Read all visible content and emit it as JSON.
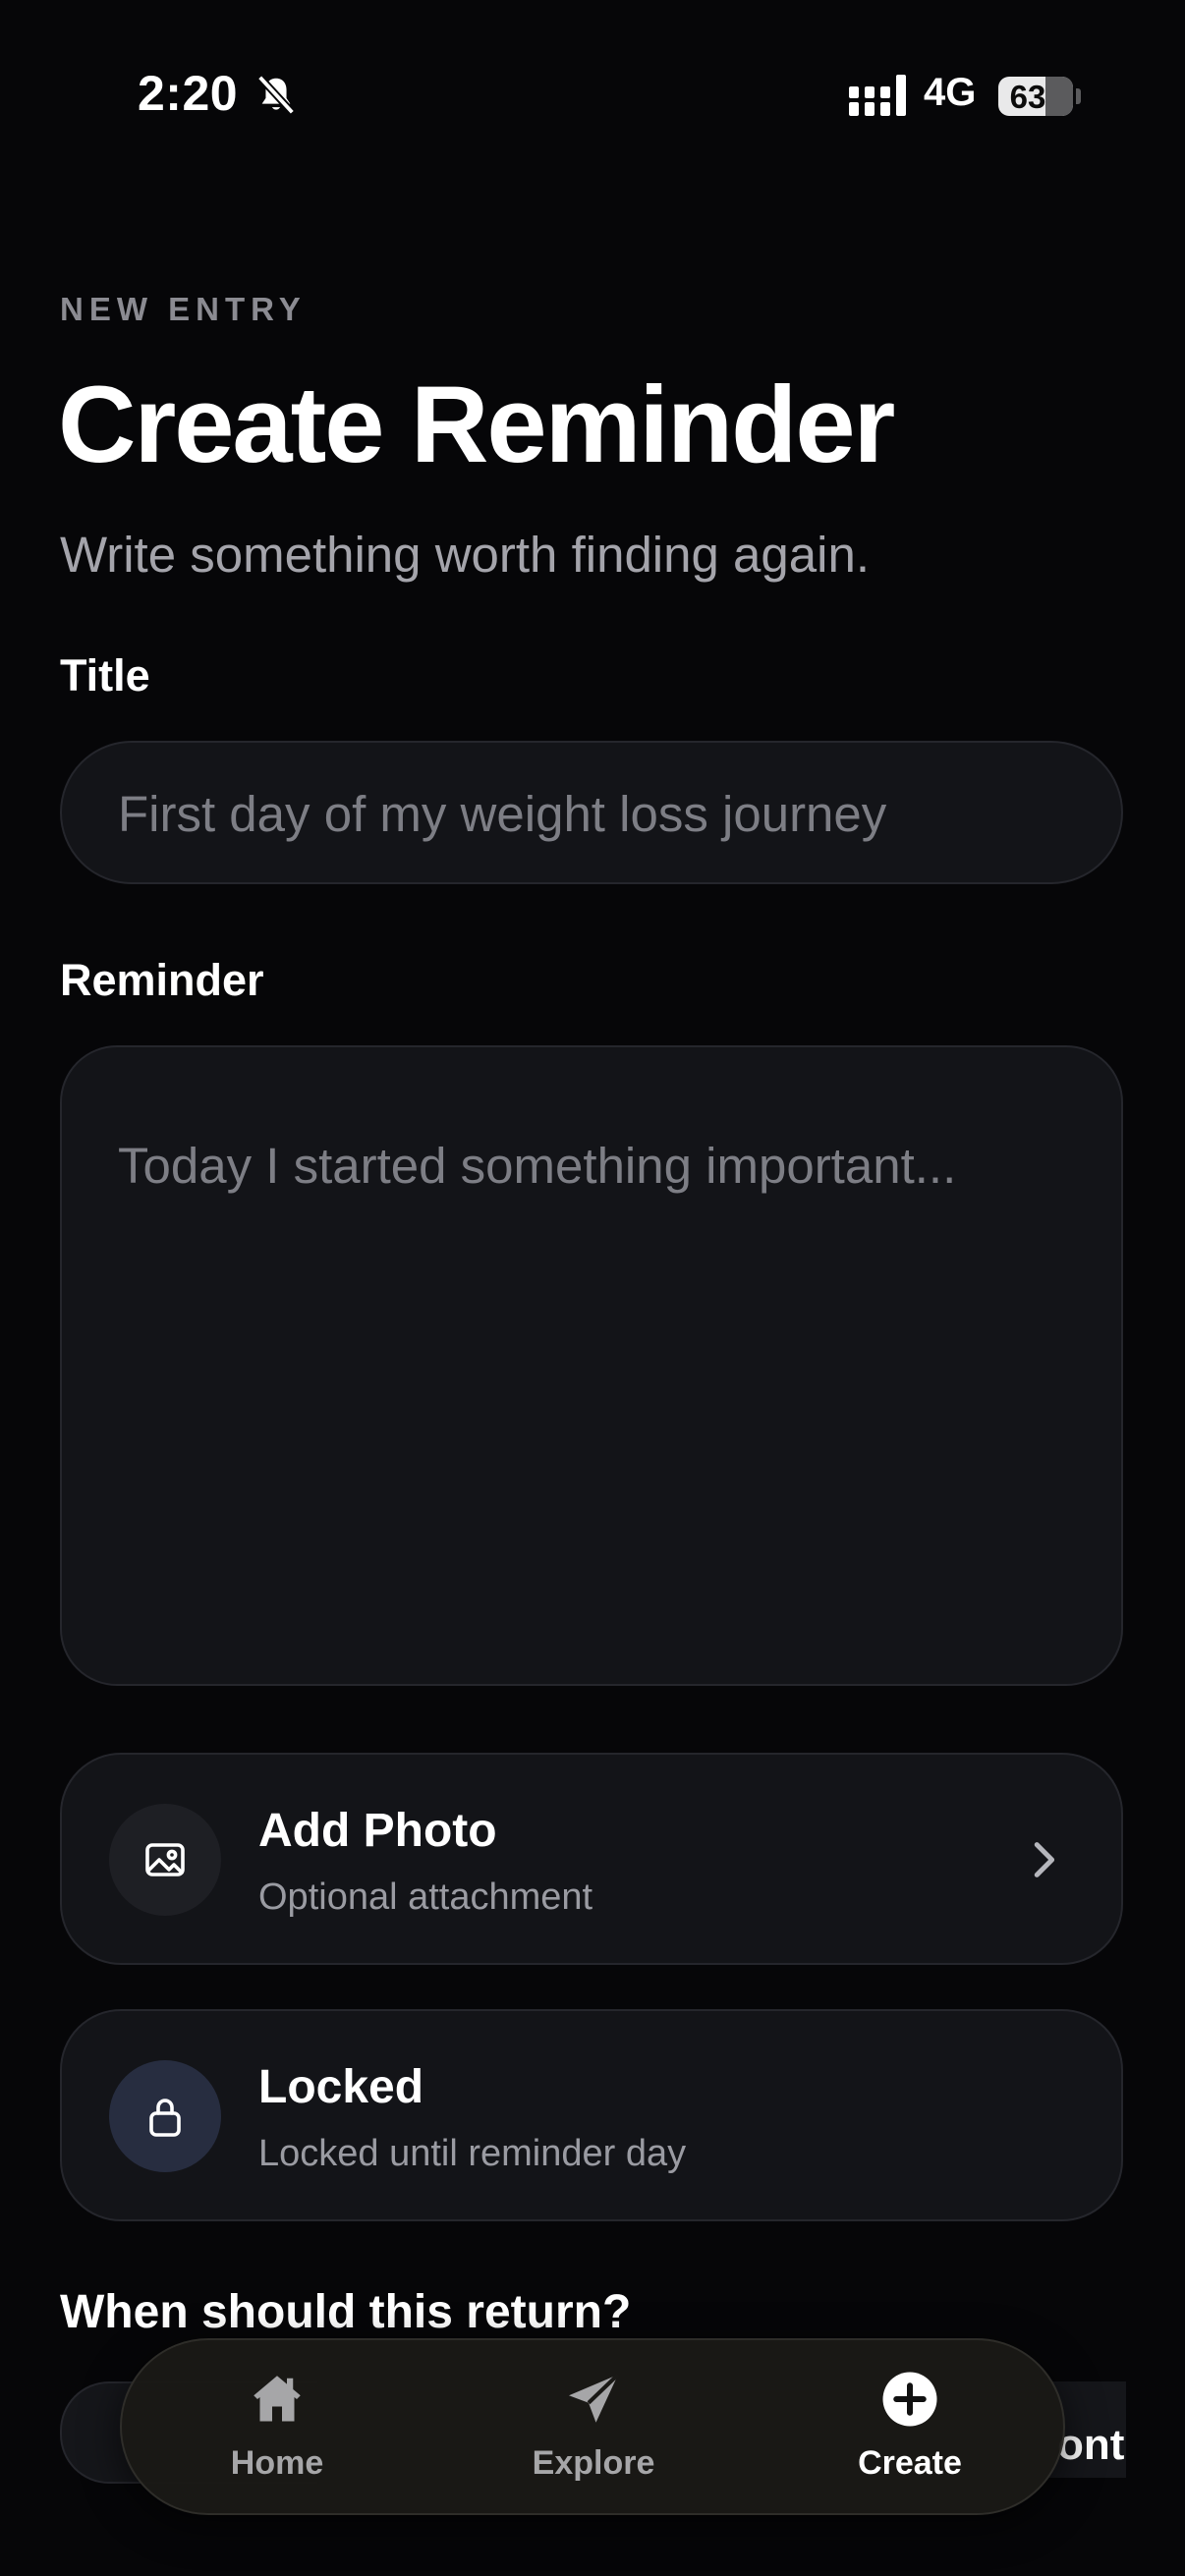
{
  "status_bar": {
    "time": "2:20",
    "network": "4G",
    "battery": "63",
    "battery_level": 0.63,
    "icons": [
      "bell-slash-icon",
      "signal-icon",
      "battery-icon"
    ]
  },
  "header": {
    "eyebrow": "NEW ENTRY",
    "title": "Create Reminder",
    "subtitle": "Write something worth finding again."
  },
  "form": {
    "title_label": "Title",
    "title_placeholder": "First day of my weight loss journey",
    "title_value": "",
    "reminder_label": "Reminder",
    "reminder_placeholder": "Today I started something important...",
    "reminder_value": ""
  },
  "options": {
    "photo": {
      "title": "Add Photo",
      "subtitle": "Optional attachment",
      "icon": "image-icon"
    },
    "locked": {
      "title": "Locked",
      "subtitle": "Locked until reminder day",
      "icon": "lock-icon"
    }
  },
  "schedule": {
    "heading": "When should this return?",
    "partial_option_text": "ont"
  },
  "tab_bar": {
    "tabs": [
      {
        "label": "Home",
        "icon": "house-icon",
        "active": false
      },
      {
        "label": "Explore",
        "icon": "paper-plane-icon",
        "active": false
      },
      {
        "label": "Create",
        "icon": "plus-circle-icon",
        "active": true
      }
    ]
  },
  "colors": {
    "background": "#060608",
    "card": "#131418",
    "border": "#25262c",
    "muted_text": "#9a9ba2",
    "lock_accent": "#272d40"
  }
}
